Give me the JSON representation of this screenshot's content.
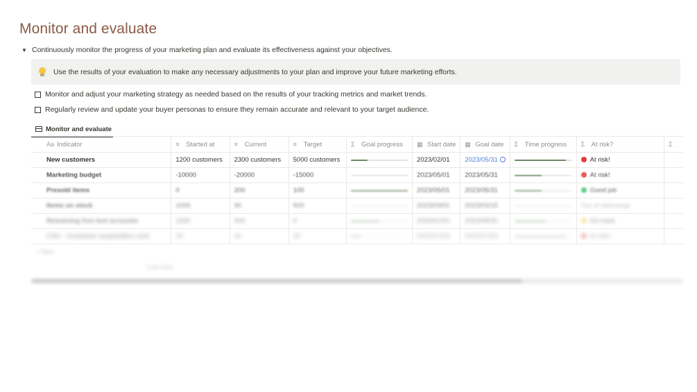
{
  "page_title": "Monitor and evaluate",
  "toggle": {
    "text": "Continuously monitor the progress of your marketing plan and evaluate its effectiveness against your objectives.",
    "icon": "triangle-down-icon"
  },
  "callout": {
    "icon": "lightbulb-icon",
    "text": "Use the results of your evaluation to make any necessary adjustments to your plan and improve your future marketing efforts."
  },
  "todos": [
    {
      "text": "Monitor and adjust your marketing strategy as needed based on the results of your tracking metrics and market trends.",
      "checked": false
    },
    {
      "text": "Regularly review and update your buyer personas to ensure they remain accurate and relevant to your target audience.",
      "checked": false
    }
  ],
  "view_tab": {
    "label": "Monitor and evaluate",
    "icon": "table-icon"
  },
  "columns": [
    {
      "icon": "Aa",
      "label": "Indicator"
    },
    {
      "icon": "≡",
      "label": "Started at"
    },
    {
      "icon": "≡",
      "label": "Current"
    },
    {
      "icon": "≡",
      "label": "Target"
    },
    {
      "icon": "Σ",
      "label": "Goal progress"
    },
    {
      "icon": "▦",
      "label": "Start date"
    },
    {
      "icon": "▦",
      "label": "Goal date"
    },
    {
      "icon": "Σ",
      "label": "Time progress"
    },
    {
      "icon": "Σ",
      "label": "At risk?"
    },
    {
      "icon": "Σ",
      "label": ""
    }
  ],
  "rows": [
    {
      "indicator": "New customers",
      "started": "1200 customers",
      "current": "2300 customers",
      "target": "5000 customers",
      "goal_progress": 0.29,
      "start_date": "2023/02/01",
      "goal_date": "2023/05/31",
      "goal_date_link": true,
      "time_progress": 0.9,
      "status": "At risk!",
      "status_color": "#e03e3e"
    },
    {
      "indicator": "Marketing budget",
      "started": "-10000",
      "current": "-20000",
      "target": "-15000",
      "goal_progress": 0.0,
      "start_date": "2023/05/01",
      "goal_date": "2023/05/31",
      "goal_date_link": false,
      "time_progress": 0.48,
      "status": "At risk!",
      "status_color": "#e03e3e"
    },
    {
      "indicator": "Presold items",
      "started": "0",
      "current": "200",
      "target": "100",
      "goal_progress": 1.0,
      "start_date": "2023/05/01",
      "goal_date": "2023/05/31",
      "goal_date_link": false,
      "time_progress": 0.48,
      "status": "Good job",
      "status_color": "#2dbd5a"
    },
    {
      "indicator": "Items on stock",
      "started": "1000",
      "current": "90",
      "target": "500",
      "goal_progress": 0.0,
      "start_date": "2023/03/01",
      "goal_date": "2023/03/15",
      "goal_date_link": false,
      "time_progress": 0.0,
      "status": "Out of daterange",
      "status_color": ""
    },
    {
      "indicator": "Remaining free test accounts",
      "started": "1000",
      "current": "500",
      "target": "0",
      "goal_progress": 0.5,
      "start_date": "2023/01/01",
      "goal_date": "2023/08/31",
      "goal_date_link": false,
      "time_progress": 0.55,
      "status": "On track",
      "status_color": "#f2c94c"
    },
    {
      "indicator": "CAC - Customer acquisition cost",
      "started": "45",
      "current": "40",
      "target": "30",
      "goal_progress": 0.18,
      "start_date": "2023/07/04",
      "goal_date": "2023/07/04",
      "goal_date_link": false,
      "time_progress": 0.9,
      "status": "At risk!",
      "status_color": "#e03e3e"
    }
  ],
  "new_row_label": "New",
  "calculate_label": "Calculate"
}
